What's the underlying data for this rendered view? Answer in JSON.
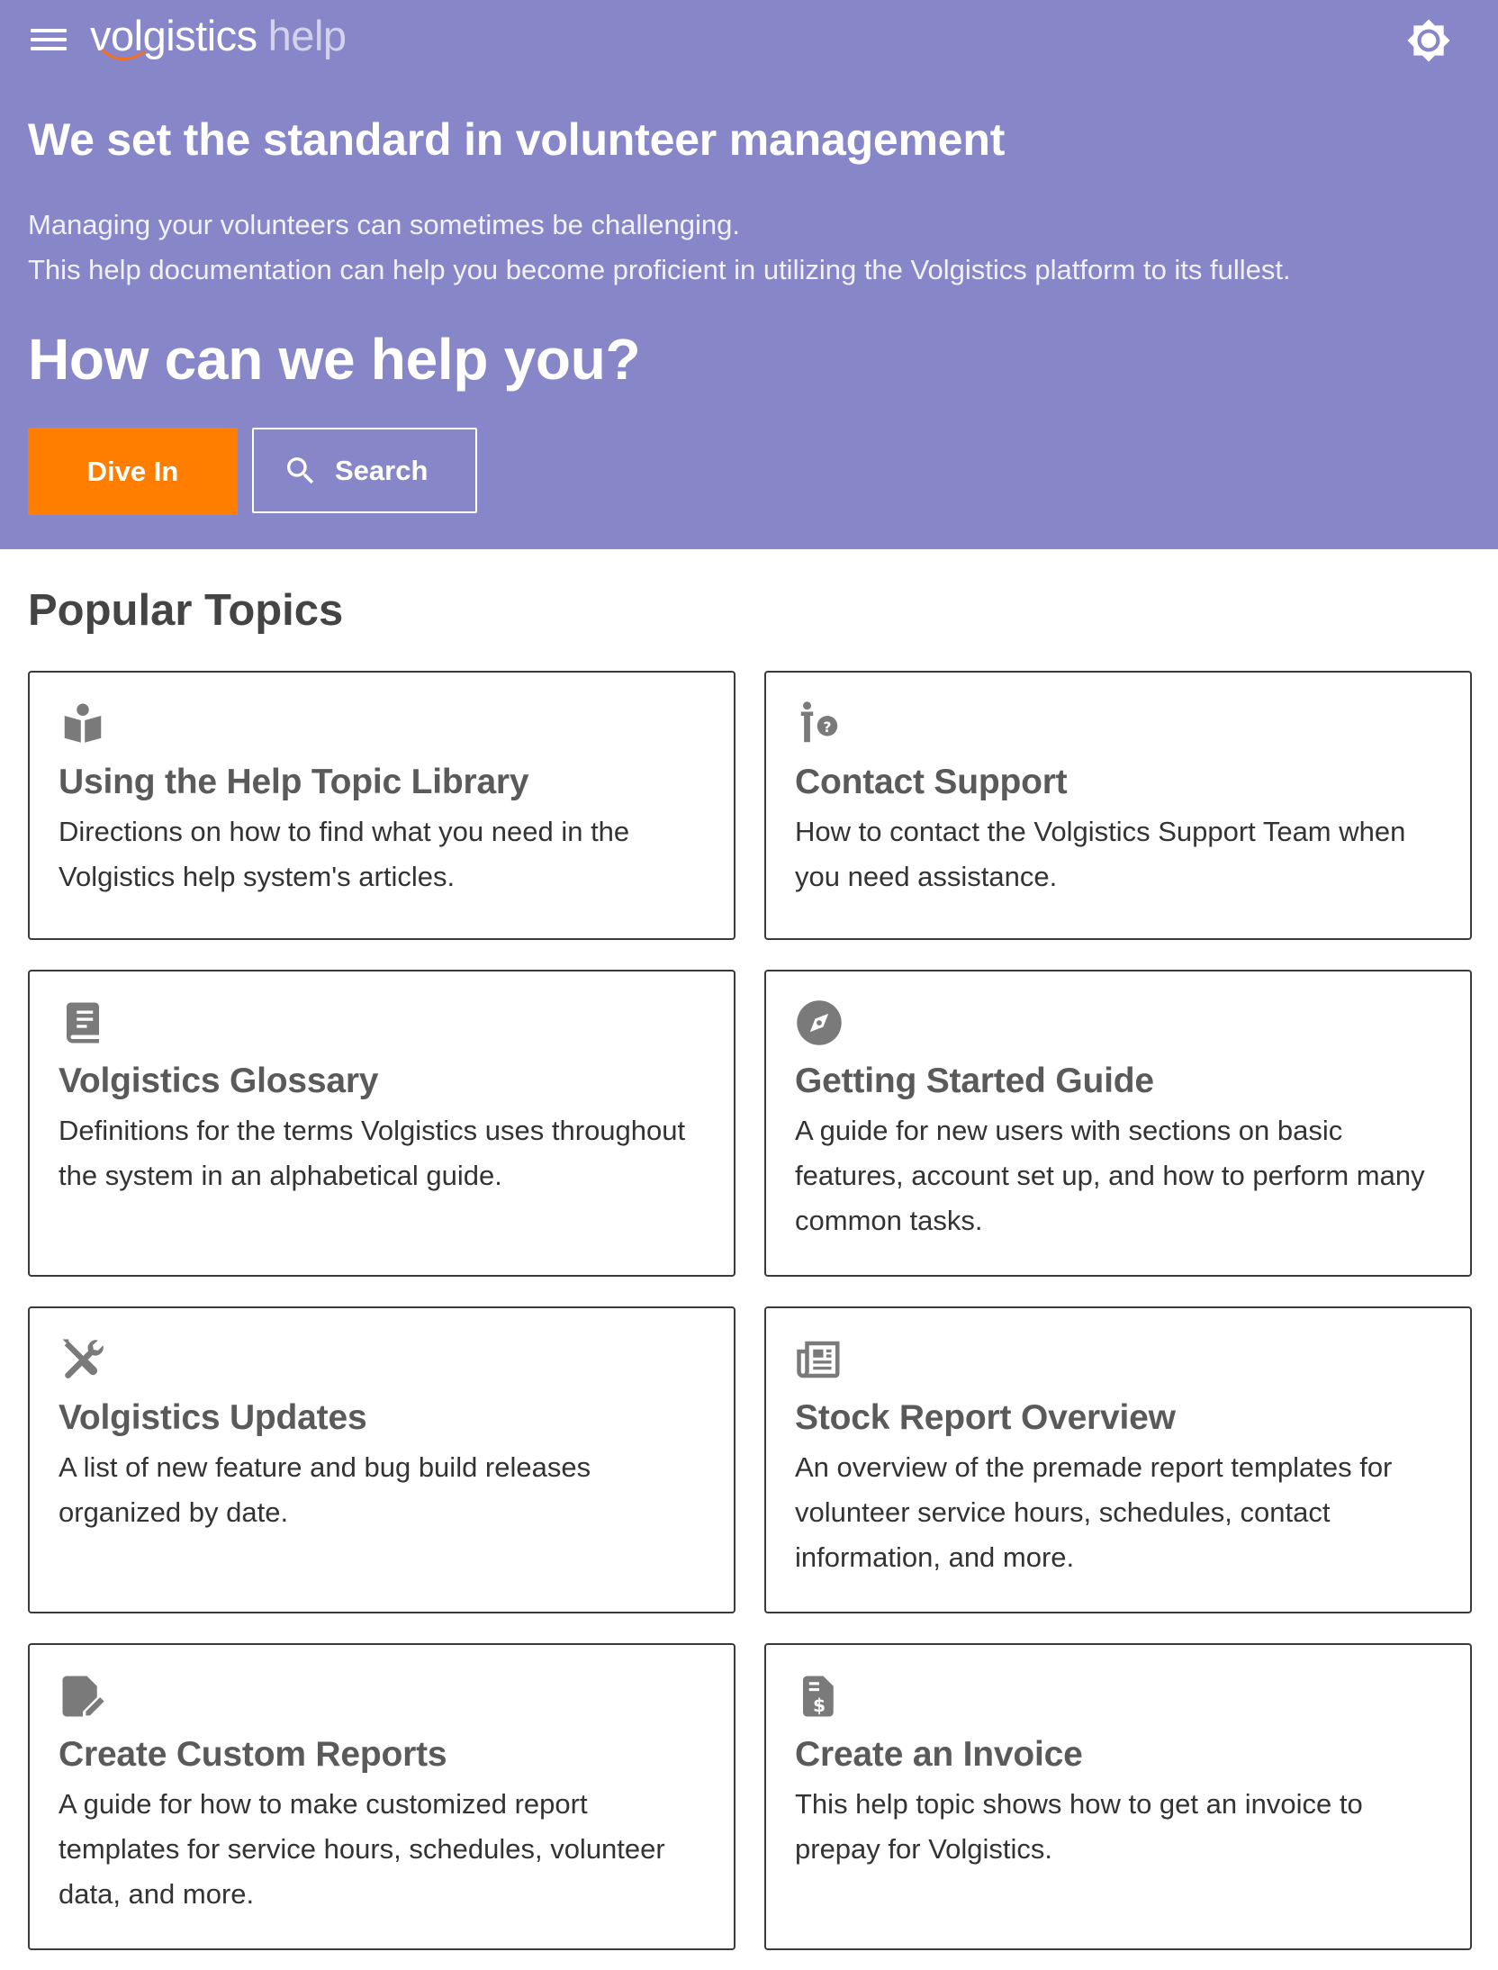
{
  "header": {
    "brand": "volgistics",
    "help_label": "help",
    "menu_icon": "hamburger-menu-icon",
    "theme_icon": "brightness-icon"
  },
  "hero": {
    "headline": "We set the standard in volunteer management",
    "intro_line_1": "Managing your volunteers can sometimes be challenging.",
    "intro_line_2": "This help documentation can help you become proficient in utilizing the Volgistics platform to its fullest.",
    "question": "How can we help you?",
    "dive_in_label": "Dive In",
    "search_label": "Search",
    "background_color": "#8786c8",
    "accent_color": "#ff7e00"
  },
  "popular": {
    "title": "Popular Topics",
    "cards": [
      {
        "icon": "reading-book-icon",
        "title": "Using the Help Topic Library",
        "description": "Directions on how to find what you need in the Volgistics help system's articles."
      },
      {
        "icon": "support-person-question-icon",
        "title": "Contact Support",
        "description": "How to contact the Volgistics Support Team when you need assistance."
      },
      {
        "icon": "glossary-book-icon",
        "title": "Volgistics Glossary",
        "description": "Definitions for the terms Volgistics uses throughout the system in an alphabetical guide."
      },
      {
        "icon": "compass-icon",
        "title": "Getting Started Guide",
        "description": "A guide for new users with sections on basic features, account set up, and how to perform many common tasks."
      },
      {
        "icon": "tools-icon",
        "title": "Volgistics Updates",
        "description": "A list of new feature and bug build releases organized by date."
      },
      {
        "icon": "newspaper-icon",
        "title": "Stock Report Overview",
        "description": "An overview of the premade report templates for volunteer service hours, schedules, contact information, and more."
      },
      {
        "icon": "edit-document-icon",
        "title": "Create Custom Reports",
        "description": "A guide for how to make customized report templates for service hours, schedules, volunteer data, and more."
      },
      {
        "icon": "invoice-dollar-icon",
        "title": "Create an Invoice",
        "description": "This help topic shows how to get an invoice to prepay for Volgistics."
      }
    ]
  }
}
